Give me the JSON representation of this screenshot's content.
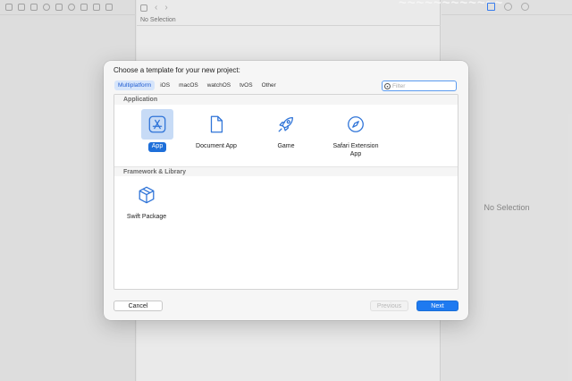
{
  "background": {
    "center_title": "No Selection",
    "right_no_selection": "No Selection",
    "watermark": "~~~~~~~~~~~~"
  },
  "dialog": {
    "title": "Choose a template for your new project:",
    "tabs": [
      {
        "label": "Multiplatform",
        "selected": true
      },
      {
        "label": "iOS",
        "selected": false
      },
      {
        "label": "macOS",
        "selected": false
      },
      {
        "label": "watchOS",
        "selected": false
      },
      {
        "label": "tvOS",
        "selected": false
      },
      {
        "label": "Other",
        "selected": false
      }
    ],
    "filter": {
      "placeholder": "Filter",
      "value": ""
    },
    "sections": [
      {
        "title": "Application",
        "items": [
          {
            "label": "App",
            "icon": "app-store-icon",
            "selected": true
          },
          {
            "label": "Document App",
            "icon": "document-icon",
            "selected": false
          },
          {
            "label": "Game",
            "icon": "rocket-icon",
            "selected": false
          },
          {
            "label": "Safari Extension App",
            "icon": "compass-icon",
            "selected": false
          }
        ]
      },
      {
        "title": "Framework & Library",
        "items": [
          {
            "label": "Swift Package",
            "icon": "package-icon",
            "selected": false
          }
        ]
      }
    ],
    "buttons": {
      "cancel": "Cancel",
      "previous": "Previous",
      "next": "Next"
    }
  },
  "colors": {
    "accent": "#1e7af0",
    "selection_bg": "#c7dbf6",
    "icon_blue": "#2f74d8"
  }
}
